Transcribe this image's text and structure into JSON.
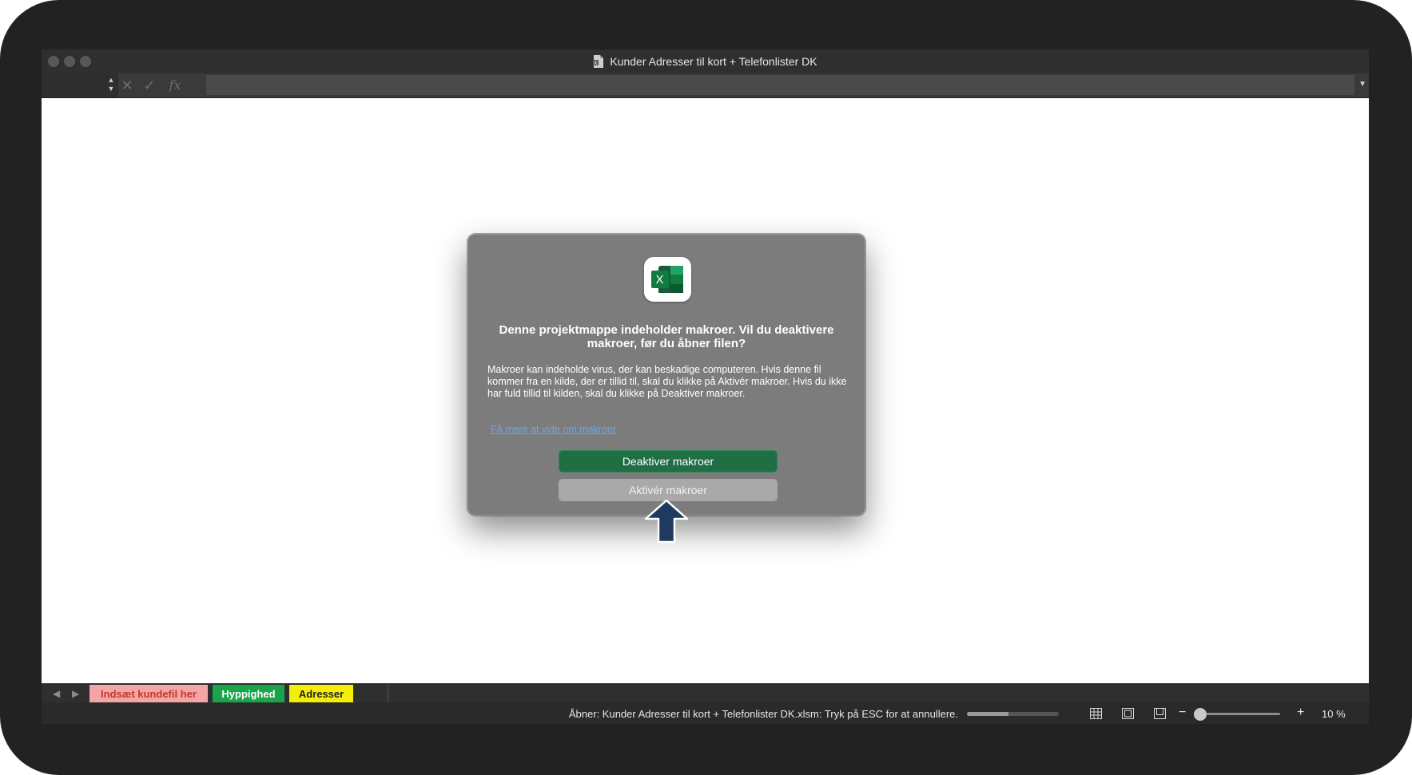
{
  "window": {
    "title": "Kunder Adresser til kort + Telefonlister DK"
  },
  "formula_bar": {
    "cancel_icon": "close-icon",
    "enter_icon": "check-icon",
    "function_label": "fx",
    "value": ""
  },
  "dialog": {
    "icon": "excel-icon",
    "heading": "Denne projektmappe indeholder makroer. Vil du deaktivere makroer, før du åbner filen?",
    "body": "Makroer kan indeholde virus, der kan beskadige computeren.  Hvis denne fil kommer fra en kilde, der er tillid til, skal du klikke på Aktivér makroer. Hvis du ikke har fuld tillid til kilden, skal du klikke på Deaktiver makroer.",
    "link": "Få mere at vide om makroer",
    "primary_button": "Deaktiver makroer",
    "secondary_button": "Aktivér makroer"
  },
  "sheet_tabs": [
    {
      "label": "Indsæt kundefil her",
      "background": "#f4a6a6",
      "color": "#c0392b"
    },
    {
      "label": "Hyppighed",
      "background": "#1aa54b",
      "color": "#ffffff"
    },
    {
      "label": "Adresser",
      "background": "#f5ed0a",
      "color": "#222222"
    }
  ],
  "status_bar": {
    "message": "Åbner: Kunder Adresser til kort + Telefonlister DK.xlsm: Tryk på ESC for at annullere.",
    "progress": 0.45,
    "zoom_level": "10 %",
    "zoom_fraction": 0.0
  },
  "colors": {
    "primary_button": "#1f6e44",
    "excel_green": "#107c41",
    "arrow": "#1e3a5f"
  }
}
